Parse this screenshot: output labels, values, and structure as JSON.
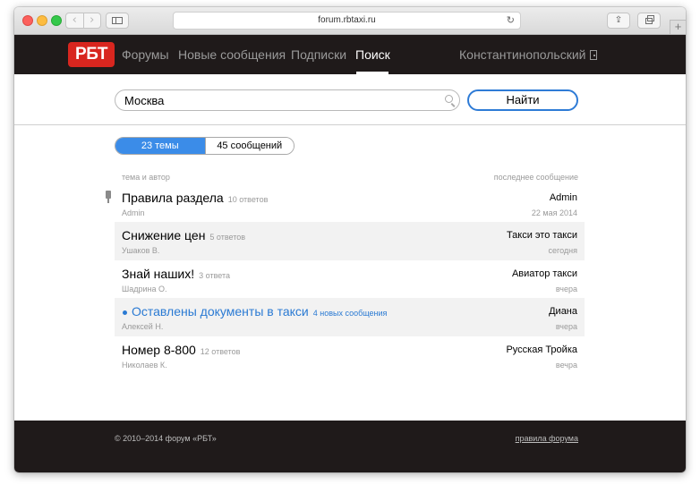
{
  "browser": {
    "url": "forum.rbtaxi.ru"
  },
  "site": {
    "logo": "РБТ",
    "nav": [
      {
        "label": "Форумы"
      },
      {
        "label": "Новые сообщения"
      },
      {
        "label": "Подписки"
      },
      {
        "label": "Поиск"
      }
    ],
    "active_nav": "Поиск",
    "user": "Константинопольский"
  },
  "search": {
    "query": "Москва",
    "button_label": "Найти"
  },
  "results": {
    "tabs": [
      {
        "label": "23 темы",
        "selected": true
      },
      {
        "label": "45 сообщений",
        "selected": false
      }
    ],
    "col_left": "тема и автор",
    "col_right": "последнее сообщение",
    "rows": [
      {
        "title": "Правила раздела",
        "count": "10 ответов",
        "author": "Admin",
        "last_author": "Admin",
        "last_date": "22 мая 2014",
        "pinned": true,
        "unread": false
      },
      {
        "title": "Снижение цен",
        "count": "5 ответов",
        "author": "Ушаков В.",
        "last_author": "Такси это такси",
        "last_date": "сегодня",
        "pinned": false,
        "unread": false
      },
      {
        "title": "Знай наших!",
        "count": "3 ответа",
        "author": "Шадрина О.",
        "last_author": "Авиатор такси",
        "last_date": "вчера",
        "pinned": false,
        "unread": false
      },
      {
        "title": "Оставлены документы в такси",
        "count": "4 новых сообщения",
        "author": "Алексей Н.",
        "last_author": "Диана",
        "last_date": "вчера",
        "pinned": false,
        "unread": true
      },
      {
        "title": "Номер 8-800",
        "count": "12 ответов",
        "author": "Николаев К.",
        "last_author": "Русская Тройка",
        "last_date": "вечра",
        "pinned": false,
        "unread": false
      }
    ]
  },
  "footer": {
    "copyright": "© 2010–2014 форум «РБТ»",
    "rules_link": "правила форума"
  },
  "colors": {
    "accent": "#2e7bd6",
    "brand_red": "#d8261f",
    "nav_bg": "#1f1a1a"
  }
}
